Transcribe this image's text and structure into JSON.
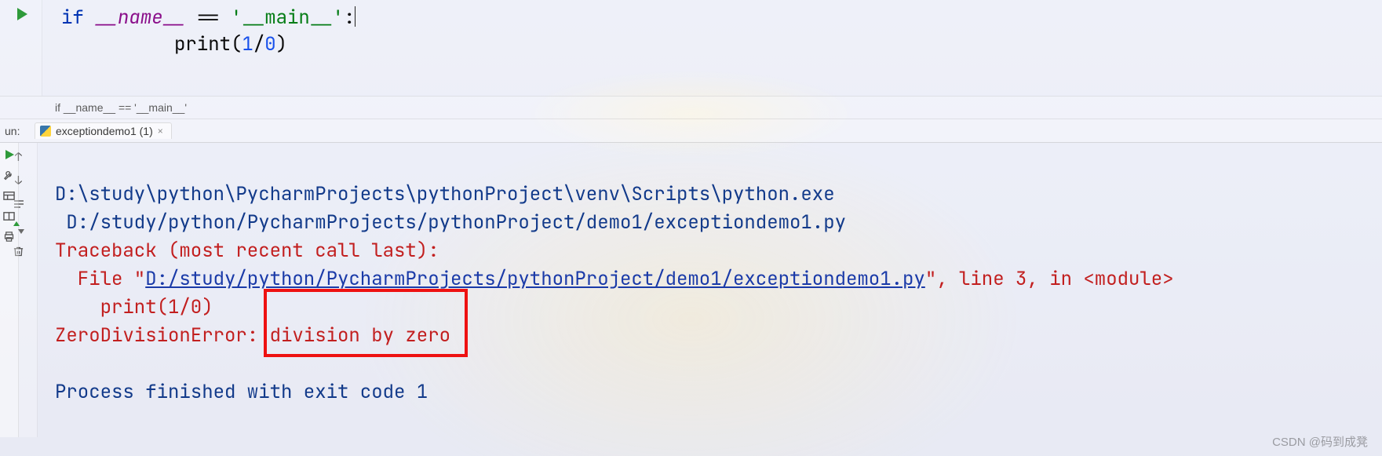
{
  "editor": {
    "lines": [
      {
        "kw": "if",
        "d1": "__name__",
        "op1": " == ",
        "str": "'__main__'",
        "colon": ":"
      },
      {
        "indent": "          ",
        "call": "print",
        "lp": "(",
        "n1": "1",
        "slash": "/",
        "n2": "0",
        "rp": ")"
      }
    ]
  },
  "breadcrumb": {
    "text": "if __name__ == '__main__'"
  },
  "runpanel": {
    "label": "un:",
    "tab_name": "exceptiondemo1 (1)"
  },
  "output": {
    "interp": "D:\\study\\python\\PycharmProjects\\pythonProject\\venv\\Scripts\\python.exe ",
    "script": " D:/study/python/PycharmProjects/pythonProject/demo1/exceptiondemo1.py",
    "tb_header": "Traceback (most recent call last):",
    "file_pre": "  File \"",
    "file_link": "D:/study/python/PycharmProjects/pythonProject/demo1/exceptiondemo1.py",
    "file_post": "\", line 3, in <module>",
    "tb_line": "    print(1/0)",
    "err_name": "ZeroDivisionError: ",
    "err_msg": "division by zero",
    "blank": "",
    "exitline": "Process finished with exit code 1"
  },
  "watermark": "CSDN @码到成凳"
}
